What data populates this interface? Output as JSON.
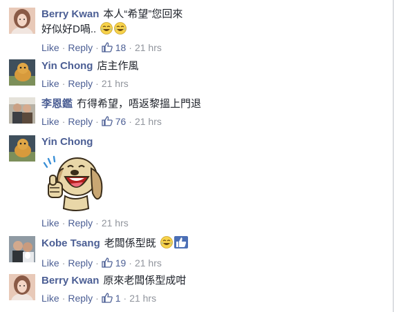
{
  "comments": [
    {
      "author": "Berry Kwan",
      "text": "本人“希望”您回來",
      "text2": "好似好D喎..",
      "emojis": [
        "laughing-tears-emoji",
        "laughing-tears-emoji"
      ],
      "actions": {
        "like": "Like",
        "reply": "Reply",
        "likes": "18",
        "time": "21 hrs"
      }
    },
    {
      "author": "Yin Chong",
      "text": "店主作風",
      "actions": {
        "like": "Like",
        "reply": "Reply",
        "time": "21 hrs"
      }
    },
    {
      "author": "李恩鑑",
      "text": "冇得希望，唔返黎搵上門退",
      "actions": {
        "like": "Like",
        "reply": "Reply",
        "likes": "76",
        "time": "21 hrs"
      }
    },
    {
      "author": "Yin Chong",
      "sticker": "laughing-dog-thumbs-up-sticker",
      "actions": {
        "like": "Like",
        "reply": "Reply",
        "time": "21 hrs"
      }
    },
    {
      "author": "Kobe Tsang",
      "text": "老闆係型既",
      "emojis": [
        "laughing-tears-emoji",
        "thumbs-up-emoji"
      ],
      "actions": {
        "like": "Like",
        "reply": "Reply",
        "likes": "19",
        "time": "21 hrs"
      }
    },
    {
      "author": "Berry Kwan",
      "text": "原來老闆係型成咁",
      "actions": {
        "like": "Like",
        "reply": "Reply",
        "likes": "1",
        "time": "21 hrs"
      }
    }
  ],
  "colors": {
    "author": "#4b5e94",
    "meta": "#90949c",
    "text": "#1d2129"
  }
}
